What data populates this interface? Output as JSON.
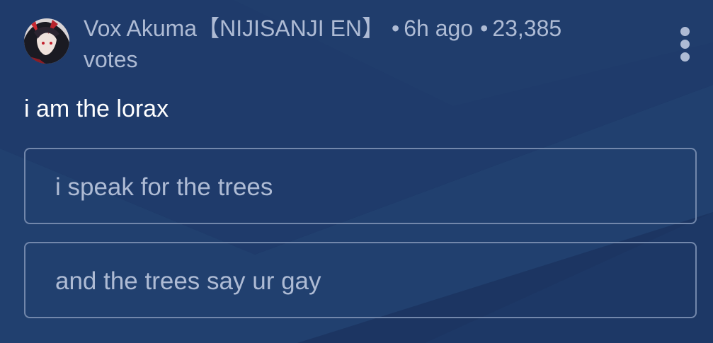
{
  "post": {
    "author": "Vox Akuma【NIJISANJI EN】",
    "time": "6h ago",
    "votes": "23,385 votes",
    "question": "i am the lorax"
  },
  "poll": {
    "options": [
      {
        "label": "i speak for the trees"
      },
      {
        "label": "and the trees say ur gay"
      }
    ]
  },
  "icons": {
    "menu": "more-vertical-icon",
    "avatar": "channel-avatar"
  },
  "colors": {
    "background": "#1c3562",
    "text_muted": "#aebbd4",
    "text_primary": "#ffffff",
    "option_border": "#7287ab"
  }
}
